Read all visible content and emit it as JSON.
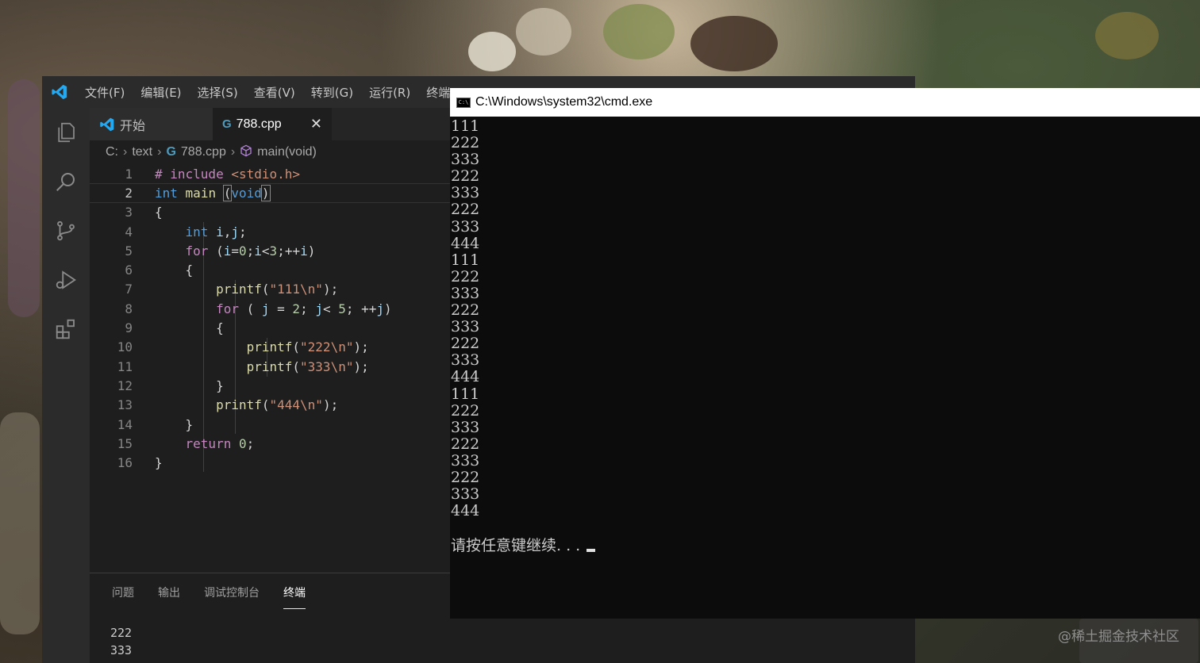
{
  "vscode": {
    "menu": [
      "文件(F)",
      "编辑(E)",
      "选择(S)",
      "查看(V)",
      "转到(G)",
      "运行(R)",
      "终端"
    ],
    "tabs": {
      "welcome": "开始",
      "file": "788.cpp",
      "close_glyph": "✕"
    },
    "breadcrumb": [
      "C:",
      "text",
      "788.cpp",
      "main(void)"
    ],
    "line_numbers": [
      "1",
      "2",
      "3",
      "4",
      "5",
      "6",
      "7",
      "8",
      "9",
      "10",
      "11",
      "12",
      "13",
      "14",
      "15",
      "16"
    ],
    "panel": {
      "tabs": [
        "问题",
        "输出",
        "调试控制台",
        "终端"
      ],
      "active_tab": "终端",
      "terminal_lines": [
        "222",
        "333"
      ]
    }
  },
  "cmd": {
    "title": "C:\\Windows\\system32\\cmd.exe",
    "icon_text": "C:\\",
    "output": [
      "111",
      "222",
      "333",
      "222",
      "333",
      "222",
      "333",
      "444",
      "111",
      "222",
      "333",
      "222",
      "333",
      "222",
      "333",
      "444",
      "111",
      "222",
      "333",
      "222",
      "333",
      "222",
      "333",
      "444"
    ],
    "prompt": "请按任意键继续. . ."
  },
  "watermark": "@稀土掘金技术社区",
  "colors": {
    "vscode_accent": "#23a9f2",
    "keyword": "#569cd6",
    "control": "#c586c0",
    "function": "#dcdcaa",
    "string": "#ce9178",
    "number": "#b5cea8"
  }
}
